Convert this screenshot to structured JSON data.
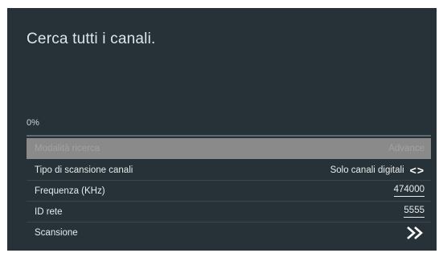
{
  "screen": {
    "title": "Cerca tutti i canali.",
    "progress": {
      "text": "0%",
      "value": 0
    }
  },
  "menu": {
    "search_mode": {
      "label": "Modalità ricerca",
      "value": "Advance"
    },
    "scan_type": {
      "label": "Tipo di scansione canali",
      "value": "Solo canali digitali",
      "arrows": "<>"
    },
    "frequency": {
      "label": "Frequenza (KHz)",
      "value": "474000"
    },
    "network_id": {
      "label": "ID rete",
      "value": "5555"
    },
    "scan": {
      "label": "Scansione",
      "icon": "double-chevron-right-icon"
    }
  },
  "colors": {
    "background": "#263237",
    "disabled_row": "#8a8a8a",
    "text": "#e6ebed"
  }
}
